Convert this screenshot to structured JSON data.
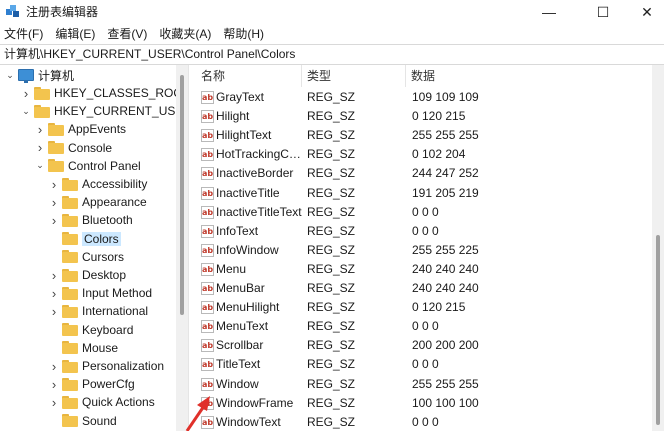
{
  "window": {
    "title": "注册表编辑器",
    "minimize": "—",
    "maximize": "☐",
    "close": "✕"
  },
  "menu": [
    "文件(F)",
    "编辑(E)",
    "查看(V)",
    "收藏夹(A)",
    "帮助(H)"
  ],
  "address": "计算机\\HKEY_CURRENT_USER\\Control Panel\\Colors",
  "tree": {
    "root": "计算机",
    "items": [
      {
        "label": "HKEY_CLASSES_ROOT",
        "level": 1,
        "expanded": false,
        "selected": false
      },
      {
        "label": "HKEY_CURRENT_USER",
        "level": 1,
        "expanded": true,
        "selected": false
      },
      {
        "label": "AppEvents",
        "level": 2,
        "expanded": false,
        "selected": false
      },
      {
        "label": "Console",
        "level": 2,
        "expanded": false,
        "selected": false
      },
      {
        "label": "Control Panel",
        "level": 2,
        "expanded": true,
        "selected": false
      },
      {
        "label": "Accessibility",
        "level": 3,
        "expanded": false,
        "selected": false
      },
      {
        "label": "Appearance",
        "level": 3,
        "expanded": false,
        "selected": false
      },
      {
        "label": "Bluetooth",
        "level": 3,
        "expanded": false,
        "selected": false
      },
      {
        "label": "Colors",
        "level": 3,
        "expanded": null,
        "selected": true
      },
      {
        "label": "Cursors",
        "level": 3,
        "expanded": null,
        "selected": false
      },
      {
        "label": "Desktop",
        "level": 3,
        "expanded": false,
        "selected": false
      },
      {
        "label": "Input Method",
        "level": 3,
        "expanded": false,
        "selected": false
      },
      {
        "label": "International",
        "level": 3,
        "expanded": false,
        "selected": false
      },
      {
        "label": "Keyboard",
        "level": 3,
        "expanded": null,
        "selected": false
      },
      {
        "label": "Mouse",
        "level": 3,
        "expanded": null,
        "selected": false
      },
      {
        "label": "Personalization",
        "level": 3,
        "expanded": false,
        "selected": false
      },
      {
        "label": "PowerCfg",
        "level": 3,
        "expanded": false,
        "selected": false
      },
      {
        "label": "Quick Actions",
        "level": 3,
        "expanded": false,
        "selected": false
      },
      {
        "label": "Sound",
        "level": 3,
        "expanded": null,
        "selected": false
      }
    ]
  },
  "list": {
    "headers": {
      "name": "名称",
      "type": "类型",
      "data": "数据"
    },
    "value_icon": "ab",
    "rows": [
      {
        "name": "GrayText",
        "type": "REG_SZ",
        "data": "109 109 109"
      },
      {
        "name": "Hilight",
        "type": "REG_SZ",
        "data": "0 120 215"
      },
      {
        "name": "HilightText",
        "type": "REG_SZ",
        "data": "255 255 255"
      },
      {
        "name": "HotTrackingColor",
        "display": "HotTrackingCo...",
        "type": "REG_SZ",
        "data": "0 102 204"
      },
      {
        "name": "InactiveBorder",
        "type": "REG_SZ",
        "data": "244 247 252"
      },
      {
        "name": "InactiveTitle",
        "type": "REG_SZ",
        "data": "191 205 219"
      },
      {
        "name": "InactiveTitleText",
        "type": "REG_SZ",
        "data": "0 0 0"
      },
      {
        "name": "InfoText",
        "type": "REG_SZ",
        "data": "0 0 0"
      },
      {
        "name": "InfoWindow",
        "type": "REG_SZ",
        "data": "255 255 225"
      },
      {
        "name": "Menu",
        "type": "REG_SZ",
        "data": "240 240 240"
      },
      {
        "name": "MenuBar",
        "type": "REG_SZ",
        "data": "240 240 240"
      },
      {
        "name": "MenuHilight",
        "type": "REG_SZ",
        "data": "0 120 215"
      },
      {
        "name": "MenuText",
        "type": "REG_SZ",
        "data": "0 0 0"
      },
      {
        "name": "Scrollbar",
        "type": "REG_SZ",
        "data": "200 200 200"
      },
      {
        "name": "TitleText",
        "type": "REG_SZ",
        "data": "0 0 0"
      },
      {
        "name": "Window",
        "type": "REG_SZ",
        "data": "255 255 255"
      },
      {
        "name": "WindowFrame",
        "type": "REG_SZ",
        "data": "100 100 100"
      },
      {
        "name": "WindowText",
        "type": "REG_SZ",
        "data": "0 0 0"
      }
    ]
  },
  "colors": {
    "selection": "#cce8ff",
    "folder": "#f3c44e",
    "annotation_arrow": "#e0302a"
  }
}
